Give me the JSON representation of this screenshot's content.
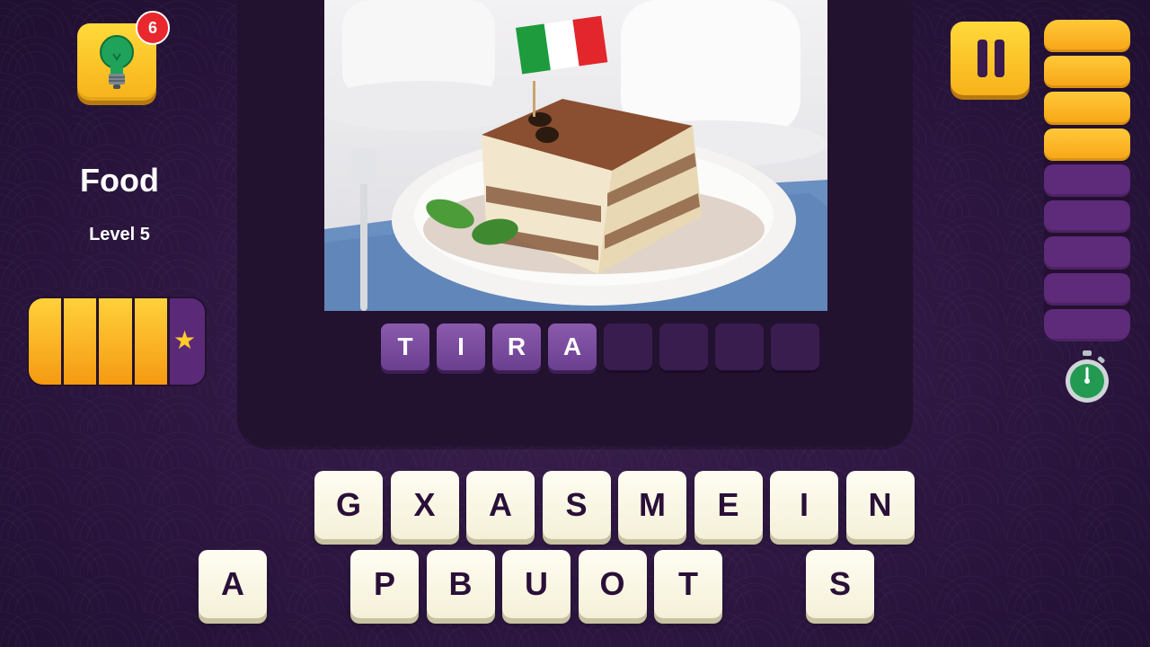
{
  "hud": {
    "hint_count": "6",
    "category": "Food",
    "level": "Level 5",
    "level_progress": {
      "filled": 4,
      "total": 5
    },
    "timer": {
      "filled": 4,
      "total": 9
    }
  },
  "answer": {
    "slots": [
      "T",
      "I",
      "R",
      "A",
      "",
      "",
      "",
      ""
    ]
  },
  "keyboard": {
    "row1": [
      "G",
      "X",
      "A",
      "S",
      "M",
      "E",
      "I",
      "N"
    ],
    "row2": [
      "A",
      "",
      "P",
      "B",
      "U",
      "O",
      "T",
      "",
      "S"
    ]
  },
  "colors": {
    "accent": "#f7b21a",
    "panel": "#22112f",
    "slot_filled": "#7a4c9f",
    "tile": "#fbf8e6"
  },
  "icons": {
    "hint": "lightbulb-icon",
    "pause": "pause-icon",
    "timer": "stopwatch-icon",
    "level": "star-icon"
  }
}
